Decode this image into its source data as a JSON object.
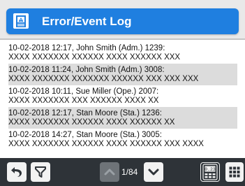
{
  "header": {
    "title": "Error/Event Log",
    "icon": "log-book-icon"
  },
  "log": {
    "entries": [
      {
        "line1": "10-02-2018 12:17,  John Smith (Adm.) 1239:",
        "line2": "XXXX XXXXXXX XXXXXX XXXX XXXXXX XXX"
      },
      {
        "line1": "10-02-2018 11:24,  John Smith (Adm.) 3008:",
        "line2": "XXXX XXXXXXX XXXXXXX XXXXXX XXX XXX XXX"
      },
      {
        "line1": "10-02-2018 10:11,  Sue Miller (Ope.) 2007:",
        "line2": "XXXX XXXXXXX XXX XXXXXX XXXX XX"
      },
      {
        "line1": "10-02-2018 12:17,  Stan Moore (Sta.) 1236:",
        "line2": "XXXX XXXXXXX XXXXXX XXXX XXXXXX XX"
      },
      {
        "line1": "10-02-2018 14:27,  Stan Moore (Sta.) 3005:",
        "line2": "XXXX XXXXXXX XXXXXX XXXX XXXXXX XXX XXXX"
      }
    ]
  },
  "toolbar": {
    "page_indicator": "1/84",
    "buttons": {
      "back": "undo-arrow-icon",
      "filter": "filter-icon",
      "page_up": "chevron-up-icon",
      "page_down": "chevron-down-icon",
      "calculator": "calculator-icon",
      "menu": "grid-menu-icon"
    },
    "calculator_display": "0.23"
  },
  "colors": {
    "header_bar": "#1f7fe0",
    "toolbar_bg": "#2e3338",
    "alt_row": "#dcdcdc"
  }
}
